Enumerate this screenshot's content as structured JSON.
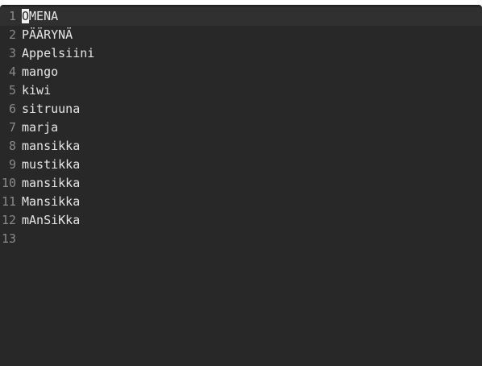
{
  "editor": {
    "current_line": 1,
    "cursor_column": 1,
    "lines": [
      {
        "number": "1",
        "text": "OMENA"
      },
      {
        "number": "2",
        "text": "PÄÄRYNÄ"
      },
      {
        "number": "3",
        "text": "Appelsiini"
      },
      {
        "number": "4",
        "text": "mango"
      },
      {
        "number": "5",
        "text": "kiwi"
      },
      {
        "number": "6",
        "text": "sitruuna"
      },
      {
        "number": "7",
        "text": "marja"
      },
      {
        "number": "8",
        "text": "mansikka"
      },
      {
        "number": "9",
        "text": "mustikka"
      },
      {
        "number": "10",
        "text": "mansikka"
      },
      {
        "number": "11",
        "text": "Mansikka"
      },
      {
        "number": "12",
        "text": "mAnSiKka"
      },
      {
        "number": "13",
        "text": ""
      }
    ]
  },
  "colors": {
    "background": "#282828",
    "current_line": "#303030",
    "gutter_text": "#8a8a8a",
    "text": "#e6e6e6",
    "cursor": "#f0f0f0"
  }
}
